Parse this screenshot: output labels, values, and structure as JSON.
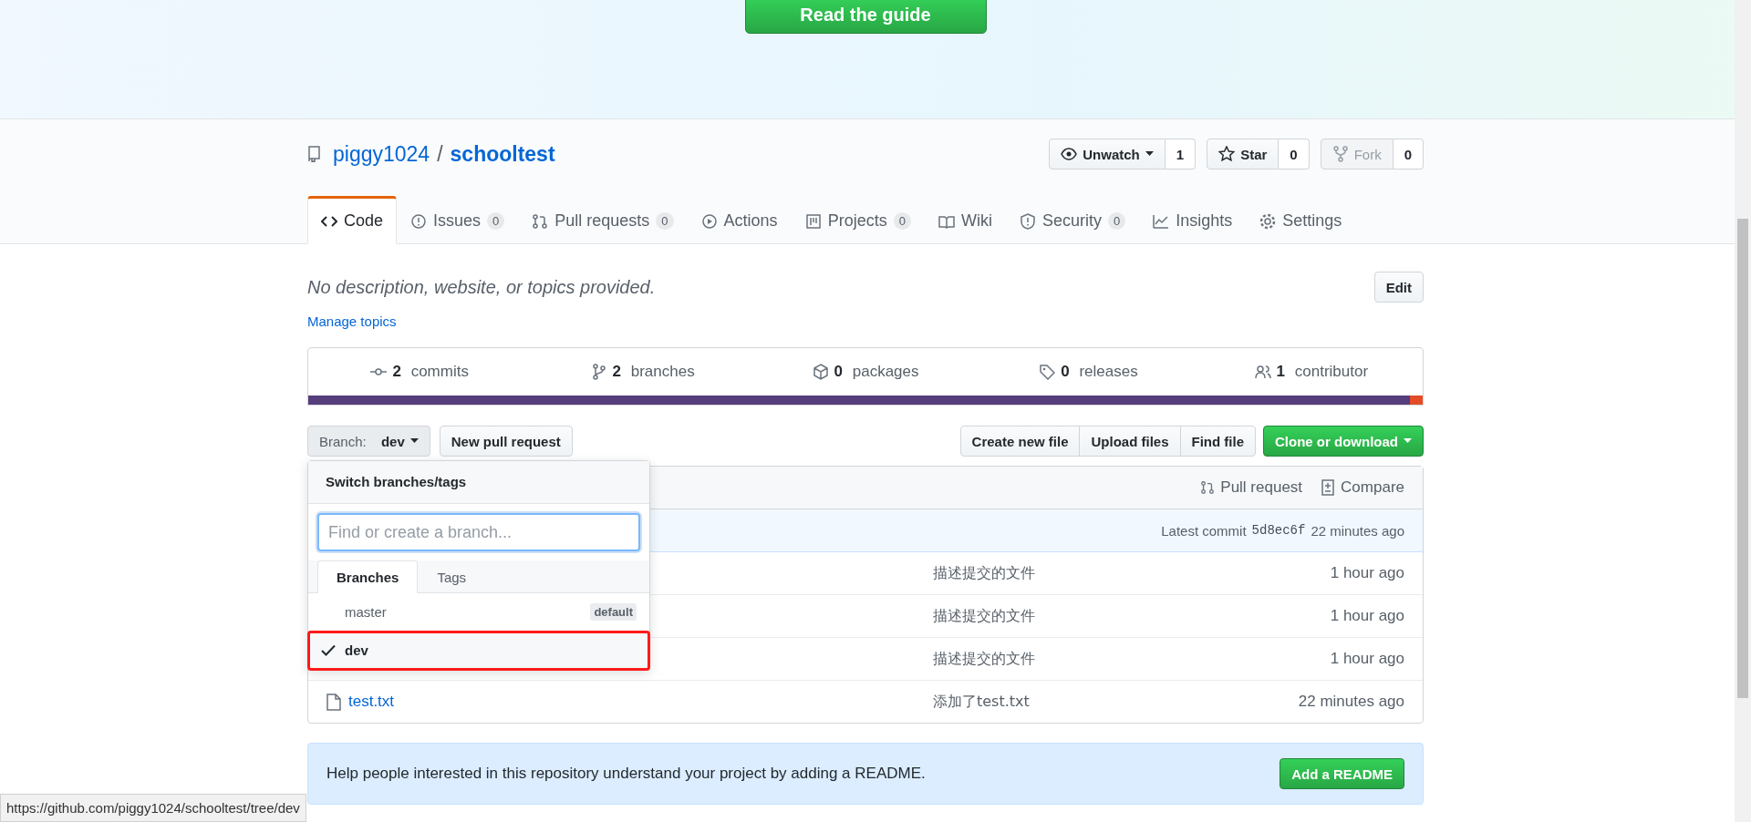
{
  "banner": {
    "button": "Read the guide"
  },
  "repo": {
    "owner": "piggy1024",
    "separator": "/",
    "name": "schooltest"
  },
  "actions": [
    {
      "label": "Unwatch",
      "count": "1",
      "caret": true,
      "disabled": false
    },
    {
      "label": "Star",
      "count": "0",
      "caret": false,
      "disabled": false
    },
    {
      "label": "Fork",
      "count": "0",
      "caret": false,
      "disabled": true
    }
  ],
  "tabs": [
    {
      "label": "Code",
      "selected": true
    },
    {
      "label": "Issues",
      "count": "0",
      "selected": false
    },
    {
      "label": "Pull requests",
      "count": "0",
      "selected": false
    },
    {
      "label": "Actions",
      "selected": false
    },
    {
      "label": "Projects",
      "count": "0",
      "selected": false
    },
    {
      "label": "Wiki",
      "selected": false
    },
    {
      "label": "Security",
      "count": "0",
      "selected": false
    },
    {
      "label": "Insights",
      "selected": false
    },
    {
      "label": "Settings",
      "selected": false
    }
  ],
  "description": "No description, website, or topics provided.",
  "edit_button": "Edit",
  "manage_topics": "Manage topics",
  "stats": [
    {
      "number": "2",
      "label": "commits"
    },
    {
      "number": "2",
      "label": "branches"
    },
    {
      "number": "0",
      "label": "packages"
    },
    {
      "number": "0",
      "label": "releases"
    },
    {
      "number": "1",
      "label": "contributor"
    }
  ],
  "languages": [
    {
      "color": "#563d7c"
    },
    {
      "color": "#e34c26"
    }
  ],
  "branch_button": {
    "prefix": "Branch:",
    "branch": "dev"
  },
  "new_pull_request": "New pull request",
  "file_buttons": [
    "Create new file",
    "Upload files",
    "Find file"
  ],
  "clone_button": "Clone or download",
  "table_header": {
    "pull_request": "Pull request",
    "compare": "Compare"
  },
  "latest_commit": {
    "label": "Latest commit",
    "sha": "5d8ec6f",
    "time": "22 minutes ago"
  },
  "files": [
    {
      "message": "描述提交的文件",
      "time": "1 hour ago"
    },
    {
      "message": "描述提交的文件",
      "time": "1 hour ago"
    },
    {
      "message": "描述提交的文件",
      "time": "1 hour ago"
    },
    {
      "name": "test.txt",
      "message": "添加了test.txt",
      "time": "22 minutes ago"
    }
  ],
  "dropdown": {
    "title": "Switch branches/tags",
    "placeholder": "Find or create a branch...",
    "tabs": [
      {
        "label": "Branches",
        "selected": true
      },
      {
        "label": "Tags",
        "selected": false
      }
    ],
    "branches": [
      {
        "name": "master",
        "badge": "default",
        "selected": false,
        "highlighted": false
      },
      {
        "name": "dev",
        "selected": true,
        "highlighted": true
      }
    ]
  },
  "readme": {
    "text": "Help people interested in this repository understand your project by adding a README.",
    "button": "Add a README"
  },
  "status_url": "https://github.com/piggy1024/schooltest/tree/dev"
}
